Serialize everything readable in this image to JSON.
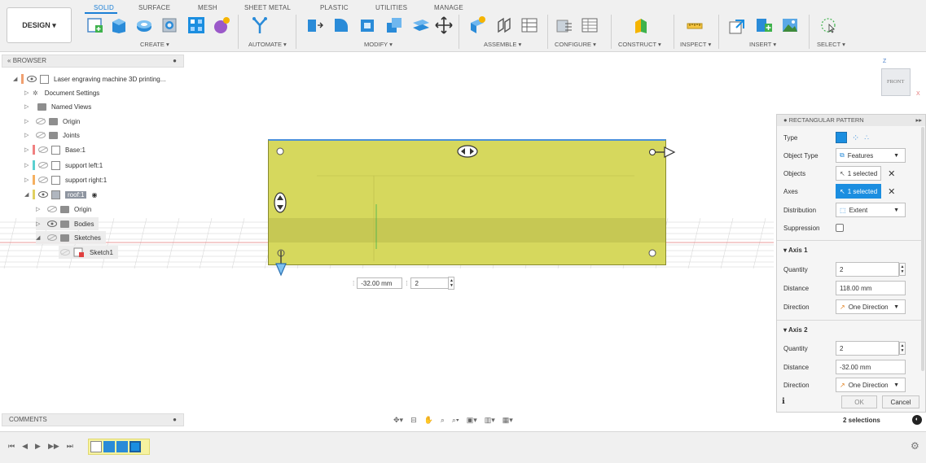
{
  "toolbar": {
    "design_label": "DESIGN ▾",
    "tabs": [
      {
        "label": "SOLID",
        "active": true
      },
      {
        "label": "SURFACE",
        "active": false
      },
      {
        "label": "MESH",
        "active": false
      },
      {
        "label": "SHEET METAL",
        "active": false
      },
      {
        "label": "PLASTIC",
        "active": false
      },
      {
        "label": "UTILITIES",
        "active": false
      },
      {
        "label": "MANAGE",
        "active": false
      }
    ],
    "groups": [
      "CREATE ▾",
      "AUTOMATE ▾",
      "MODIFY ▾",
      "ASSEMBLE ▾",
      "CONFIGURE ▾",
      "CONSTRUCT ▾",
      "INSPECT ▾",
      "INSERT ▾",
      "SELECT ▾"
    ],
    "accent": "#1b7fd6"
  },
  "browser": {
    "header": "BROWSER",
    "items": [
      {
        "label": "Laser engraving machine 3D printing...",
        "icon": "component-icon"
      },
      {
        "label": "Document Settings",
        "icon": "gear-icon"
      },
      {
        "label": "Named Views",
        "icon": "folder-icon"
      },
      {
        "label": "Origin",
        "icon": "folder-icon"
      },
      {
        "label": "Joints",
        "icon": "folder-icon"
      },
      {
        "label": "Base:1",
        "icon": "component-icon"
      },
      {
        "label": "support left:1",
        "icon": "component-icon"
      },
      {
        "label": "support right:1",
        "icon": "component-icon"
      },
      {
        "label": "roof:1",
        "icon": "component-icon"
      },
      {
        "label": "Origin",
        "icon": "folder-icon"
      },
      {
        "label": "Bodies",
        "icon": "folder-icon"
      },
      {
        "label": "Sketches",
        "icon": "folder-icon"
      },
      {
        "label": "Sketch1",
        "icon": "sketch-icon"
      }
    ]
  },
  "viewcube": {
    "face": "FRONT",
    "z": "Z",
    "x": "X"
  },
  "dimension_input": {
    "distance": "-32.00 mm",
    "quantity": "2"
  },
  "dialog": {
    "title": "RECTANGULAR PATTERN",
    "type_label": "Type",
    "object_type_label": "Object Type",
    "object_type_value": "Features",
    "objects_label": "Objects",
    "objects_value": "1 selected",
    "axes_label": "Axes",
    "axes_value": "1 selected",
    "distribution_label": "Distribution",
    "distribution_value": "Extent",
    "suppression_label": "Suppression",
    "axis1": {
      "title": "Axis 1",
      "quantity_label": "Quantity",
      "quantity": "2",
      "distance_label": "Distance",
      "distance": "118.00 mm",
      "direction_label": "Direction",
      "direction": "One Direction"
    },
    "axis2": {
      "title": "Axis 2",
      "quantity_label": "Quantity",
      "quantity": "2",
      "distance_label": "Distance",
      "distance": "-32.00 mm",
      "direction_label": "Direction",
      "direction": "One Direction"
    },
    "ok": "OK",
    "cancel": "Cancel"
  },
  "comments_label": "COMMENTS",
  "status": {
    "selections": "2 selections"
  }
}
